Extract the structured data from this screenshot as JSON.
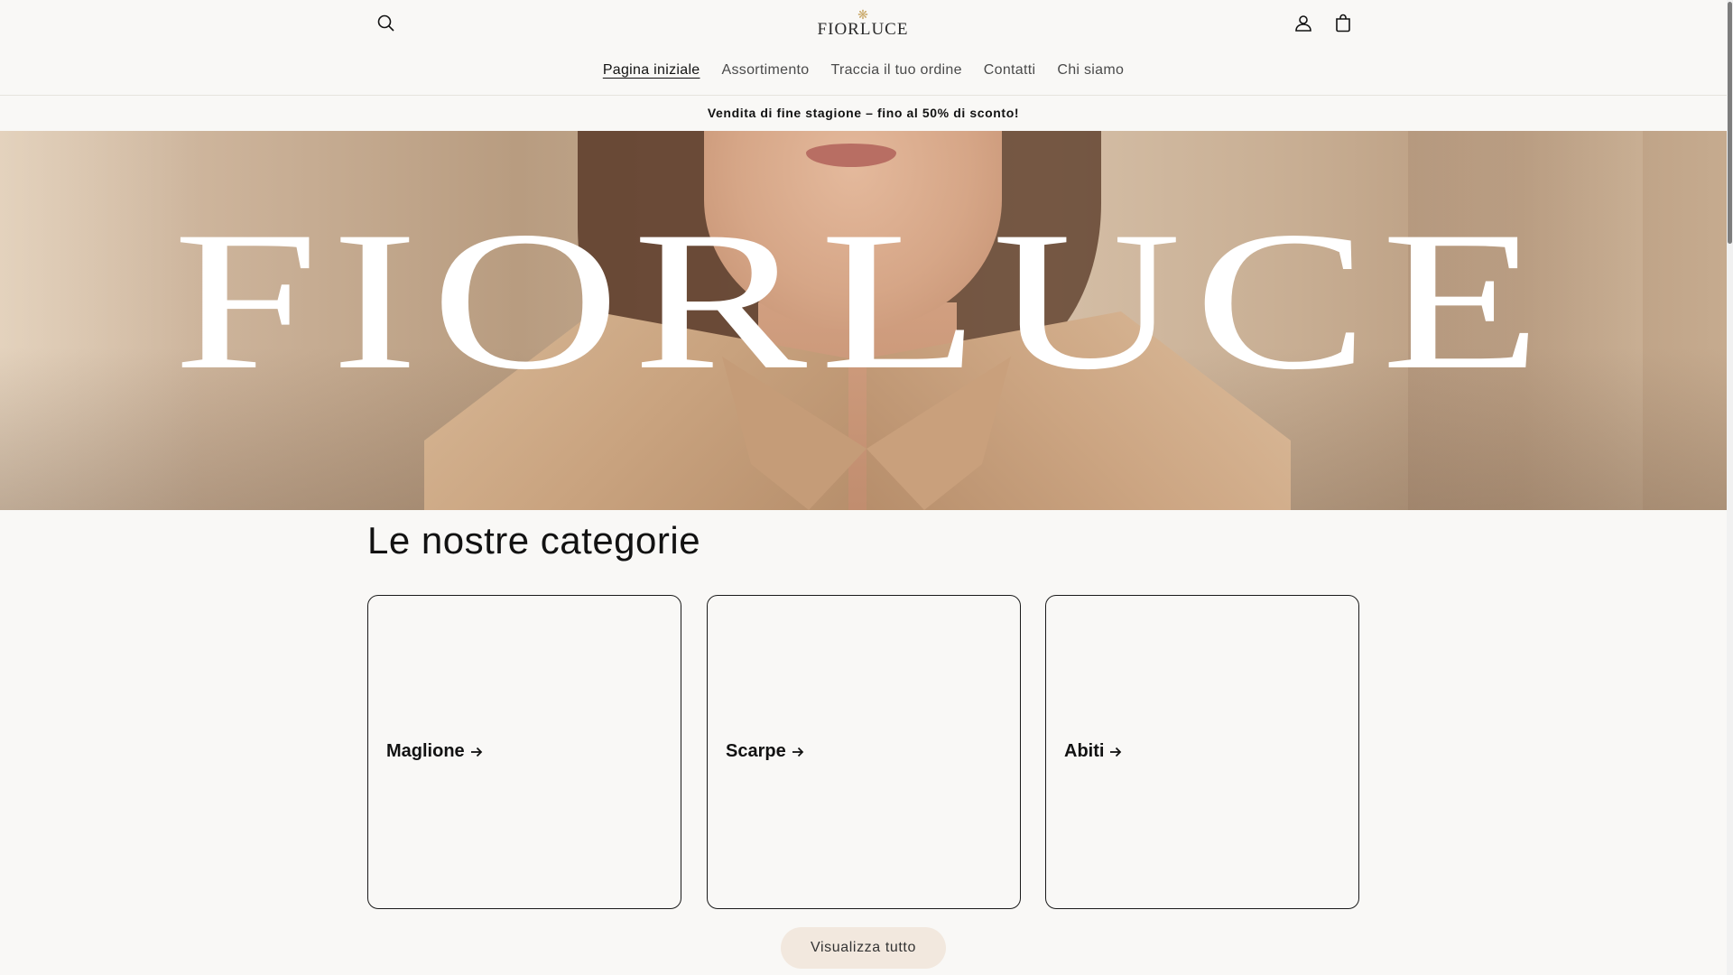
{
  "header": {
    "logo_text": "FIORLUCE",
    "icons": [
      "search-icon",
      "account-icon",
      "cart-icon"
    ]
  },
  "nav": {
    "items": [
      {
        "label": "Pagina iniziale",
        "active": true
      },
      {
        "label": "Assortimento",
        "active": false
      },
      {
        "label": "Traccia il tuo ordine",
        "active": false
      },
      {
        "label": "Contatti",
        "active": false
      },
      {
        "label": "Chi siamo",
        "active": false
      }
    ]
  },
  "announcement": "Vendita di fine stagione – fino al 50% di sconto!",
  "hero": {
    "brand_text": "FIORLUCE"
  },
  "categories": {
    "title": "Le nostre categorie",
    "items": [
      {
        "label": "Maglione"
      },
      {
        "label": "Scarpe"
      },
      {
        "label": "Abiti"
      }
    ],
    "view_all_label": "Visualizza tutto"
  },
  "colors": {
    "background": "#f9f8f6",
    "text": "#121212",
    "button_bg": "#f2e8de",
    "logo_accent": "#c9a869"
  }
}
